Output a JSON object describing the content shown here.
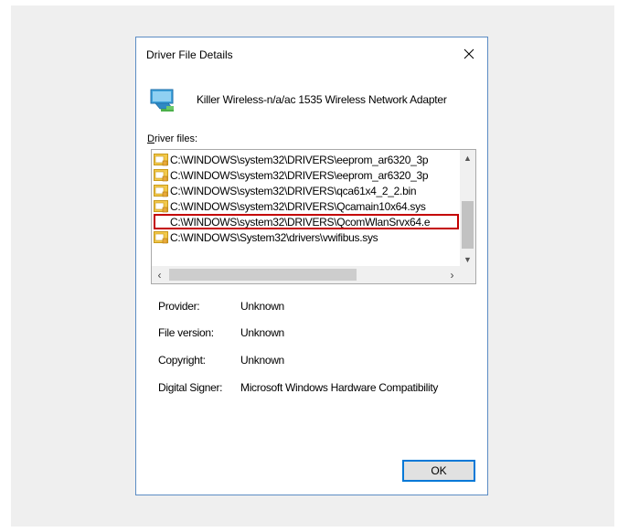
{
  "dialog": {
    "title": "Driver File Details",
    "device_name": "Killer Wireless-n/a/ac 1535 Wireless Network Adapter",
    "files_label_accel": "D",
    "files_label_rest": "river files:",
    "files": [
      "C:\\WINDOWS\\system32\\DRIVERS\\eeprom_ar6320_3p",
      "C:\\WINDOWS\\system32\\DRIVERS\\eeprom_ar6320_3p",
      "C:\\WINDOWS\\system32\\DRIVERS\\qca61x4_2_2.bin",
      "C:\\WINDOWS\\system32\\DRIVERS\\Qcamain10x64.sys",
      "C:\\WINDOWS\\system32\\DRIVERS\\QcomWlanSrvx64.e",
      "C:\\WINDOWS\\System32\\drivers\\vwifibus.sys"
    ],
    "selected_index": 4,
    "details": {
      "provider_label": "Provider:",
      "provider_value": "Unknown",
      "file_version_label": "File version:",
      "file_version_value": "Unknown",
      "copyright_label": "Copyright:",
      "copyright_value": "Unknown",
      "signer_label": "Digital Signer:",
      "signer_value": "Microsoft Windows Hardware Compatibility"
    },
    "ok_label": "OK"
  },
  "icons": {
    "close": "close-icon",
    "device": "network-adapter-icon",
    "file": "driver-file-icon",
    "scroll_up": "chevron-up-icon",
    "scroll_down": "chevron-down-icon",
    "scroll_left": "chevron-left-icon",
    "scroll_right": "chevron-right-icon"
  },
  "colors": {
    "dialog_border": "#5b8cc4",
    "selection_outline": "#c40000",
    "accent": "#0078d7"
  }
}
